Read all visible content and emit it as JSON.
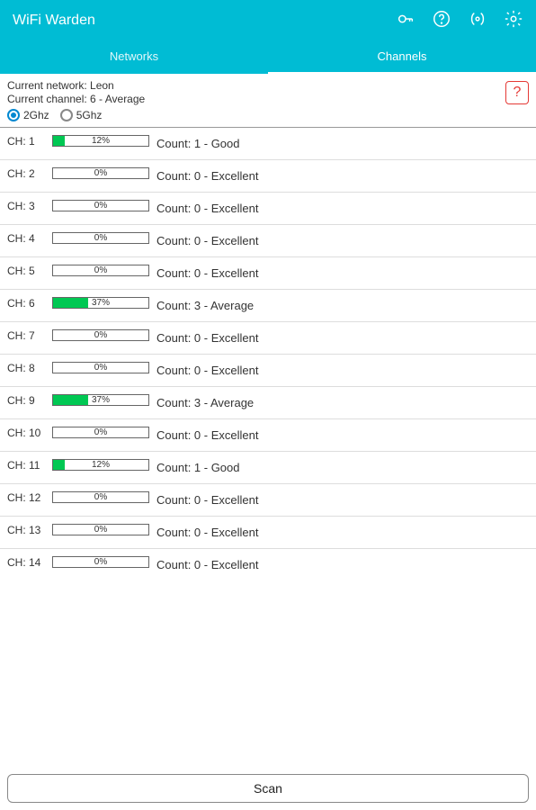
{
  "header": {
    "title": "WiFi Warden"
  },
  "tabs": [
    {
      "label": "Networks",
      "active": false
    },
    {
      "label": "Channels",
      "active": true
    }
  ],
  "info": {
    "network_line": "Current network: Leon",
    "channel_line": "Current channel: 6 - Average",
    "help_glyph": "?",
    "radios": [
      {
        "label": "2Ghz",
        "checked": true
      },
      {
        "label": "5Ghz",
        "checked": false
      }
    ]
  },
  "channels": [
    {
      "ch": "CH: 1",
      "pct": 12,
      "pct_label": "12%",
      "status": "Count: 1 - Good"
    },
    {
      "ch": "CH: 2",
      "pct": 0,
      "pct_label": "0%",
      "status": "Count: 0 - Excellent"
    },
    {
      "ch": "CH: 3",
      "pct": 0,
      "pct_label": "0%",
      "status": "Count: 0 - Excellent"
    },
    {
      "ch": "CH: 4",
      "pct": 0,
      "pct_label": "0%",
      "status": "Count: 0 - Excellent"
    },
    {
      "ch": "CH: 5",
      "pct": 0,
      "pct_label": "0%",
      "status": "Count: 0 - Excellent"
    },
    {
      "ch": "CH: 6",
      "pct": 37,
      "pct_label": "37%",
      "status": "Count: 3 - Average"
    },
    {
      "ch": "CH: 7",
      "pct": 0,
      "pct_label": "0%",
      "status": "Count: 0 - Excellent"
    },
    {
      "ch": "CH: 8",
      "pct": 0,
      "pct_label": "0%",
      "status": "Count: 0 - Excellent"
    },
    {
      "ch": "CH: 9",
      "pct": 37,
      "pct_label": "37%",
      "status": "Count: 3 - Average"
    },
    {
      "ch": "CH: 10",
      "pct": 0,
      "pct_label": "0%",
      "status": "Count: 0 - Excellent"
    },
    {
      "ch": "CH: 11",
      "pct": 12,
      "pct_label": "12%",
      "status": "Count: 1 - Good"
    },
    {
      "ch": "CH: 12",
      "pct": 0,
      "pct_label": "0%",
      "status": "Count: 0 - Excellent"
    },
    {
      "ch": "CH: 13",
      "pct": 0,
      "pct_label": "0%",
      "status": "Count: 0 - Excellent"
    },
    {
      "ch": "CH: 14",
      "pct": 0,
      "pct_label": "0%",
      "status": "Count: 0 - Excellent"
    }
  ],
  "footer": {
    "scan_label": "Scan"
  }
}
